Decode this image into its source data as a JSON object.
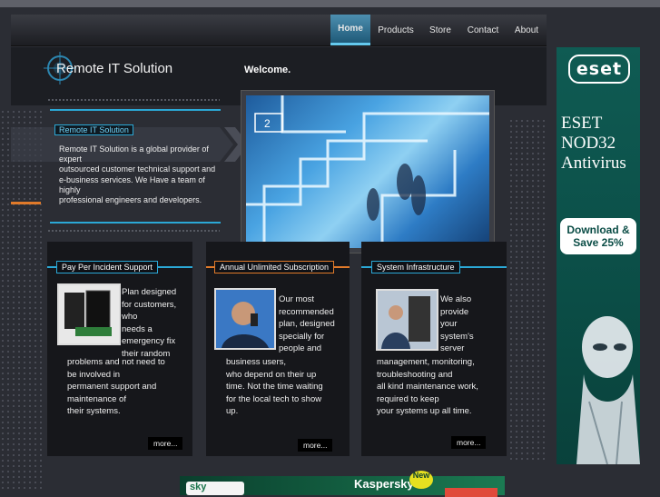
{
  "nav": {
    "items": [
      {
        "label": "Home",
        "active": true
      },
      {
        "label": "Products",
        "active": false
      },
      {
        "label": "Store",
        "active": false
      },
      {
        "label": "Contact",
        "active": false
      },
      {
        "label": "About",
        "active": false
      }
    ]
  },
  "header": {
    "brand": "Remote IT Solution",
    "welcome": "Welcome."
  },
  "about": {
    "title": "Remote IT Solution",
    "lines": [
      "Remote IT Solution is a global provider of",
      "expert",
      "outsourced customer technical support and",
      "e-business services. We Have a team of",
      "highly",
      "professional engineers and developers."
    ]
  },
  "cards": [
    {
      "title": "Pay Per Incident Support",
      "lines_right": [
        "Plan designed",
        "for customers,",
        "who",
        "needs a",
        "emergency fix",
        "their random"
      ],
      "lines_full": [
        "problems and not need to",
        "be involved in",
        "permanent support and",
        "maintenance of",
        "their systems."
      ],
      "more": "more..."
    },
    {
      "title": "Annual Unlimited Subscription",
      "lines_right": [
        "Our most",
        "recommended",
        "plan, designed",
        "specially for",
        "people and"
      ],
      "lines_full": [
        "business users,",
        "who depend on their up",
        "time. Not the time waiting",
        "for the local tech to show",
        "up."
      ],
      "more": "more..."
    },
    {
      "title": "System Infrastructure",
      "lines_right": [
        "We also",
        "provide",
        "your",
        "system's",
        "server"
      ],
      "lines_full": [
        "management, monitoring,",
        "troubleshooting and",
        "all kind maintenance work,",
        "required to keep",
        "your systems up all time."
      ],
      "more": "more..."
    }
  ],
  "ads": {
    "eset": {
      "logo": "eset",
      "title_lines": [
        "ESET",
        "NOD32",
        "Antivirus"
      ],
      "button_lines": [
        "Download &",
        "Save 25%"
      ]
    },
    "kaspersky": {
      "logo": "sky",
      "title": "Kaspersky",
      "badge": "New"
    }
  },
  "colors": {
    "accent_blue": "#2ba8d6",
    "accent_orange": "#e07a2a",
    "eset_green": "#0b4d46"
  }
}
